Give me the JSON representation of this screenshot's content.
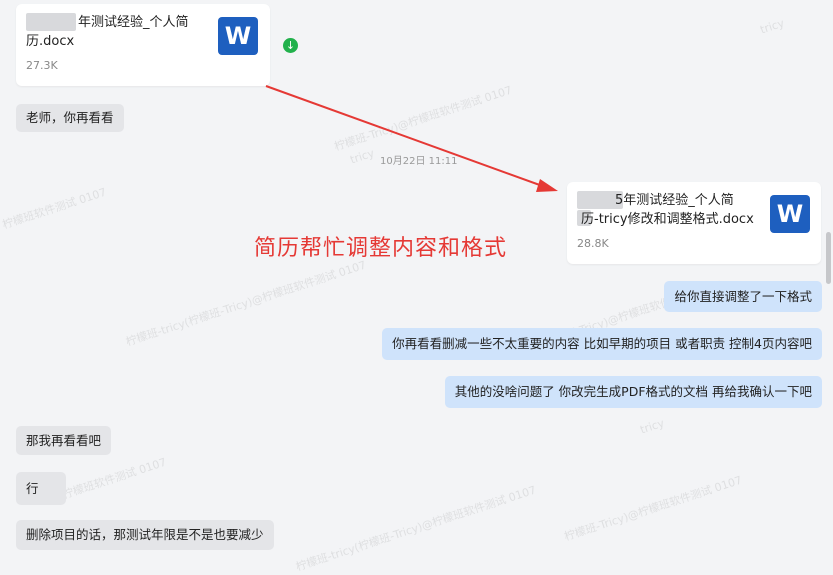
{
  "file1": {
    "name_line1": "年测试经验_个人简",
    "name_line2": "历.docx",
    "size": "27.3K"
  },
  "file2": {
    "name_line1": "5年测试经验_个人简",
    "name_line2": "历-tricy修改和调整格式.docx",
    "size": "28.8K"
  },
  "word_icon_letter": "W",
  "download_glyph": "↓",
  "timestamp": "10月22日 11:11",
  "annotation": "简历帮忙调整内容和格式",
  "messages": {
    "m1": "老师，你再看看",
    "m2": "给你直接调整了一下格式",
    "m3": "你再看看删减一些不太重要的内容   比如早期的项目   或者职责   控制4页内容吧",
    "m4": "其他的没啥问题了   你改完生成PDF格式的文档   再给我确认一下吧",
    "m5": "那我再看看吧",
    "m6": "行",
    "m7": "删除项目的话，那测试年限是不是也要减少"
  },
  "watermark": {
    "lines": [
      "柠檬班-Tricy)@柠檬班软件测试 0107",
      "柠檬班-tricy(柠檬班-Tricy)@柠檬班软件测试 0107",
      "tricy",
      "柠檬班软件测试 0107"
    ]
  },
  "colors": {
    "annotation": "#e53935",
    "word_blue": "#1e5fbf",
    "my_bubble": "#cfe3fb",
    "other_bubble": "#e4e5e8"
  }
}
